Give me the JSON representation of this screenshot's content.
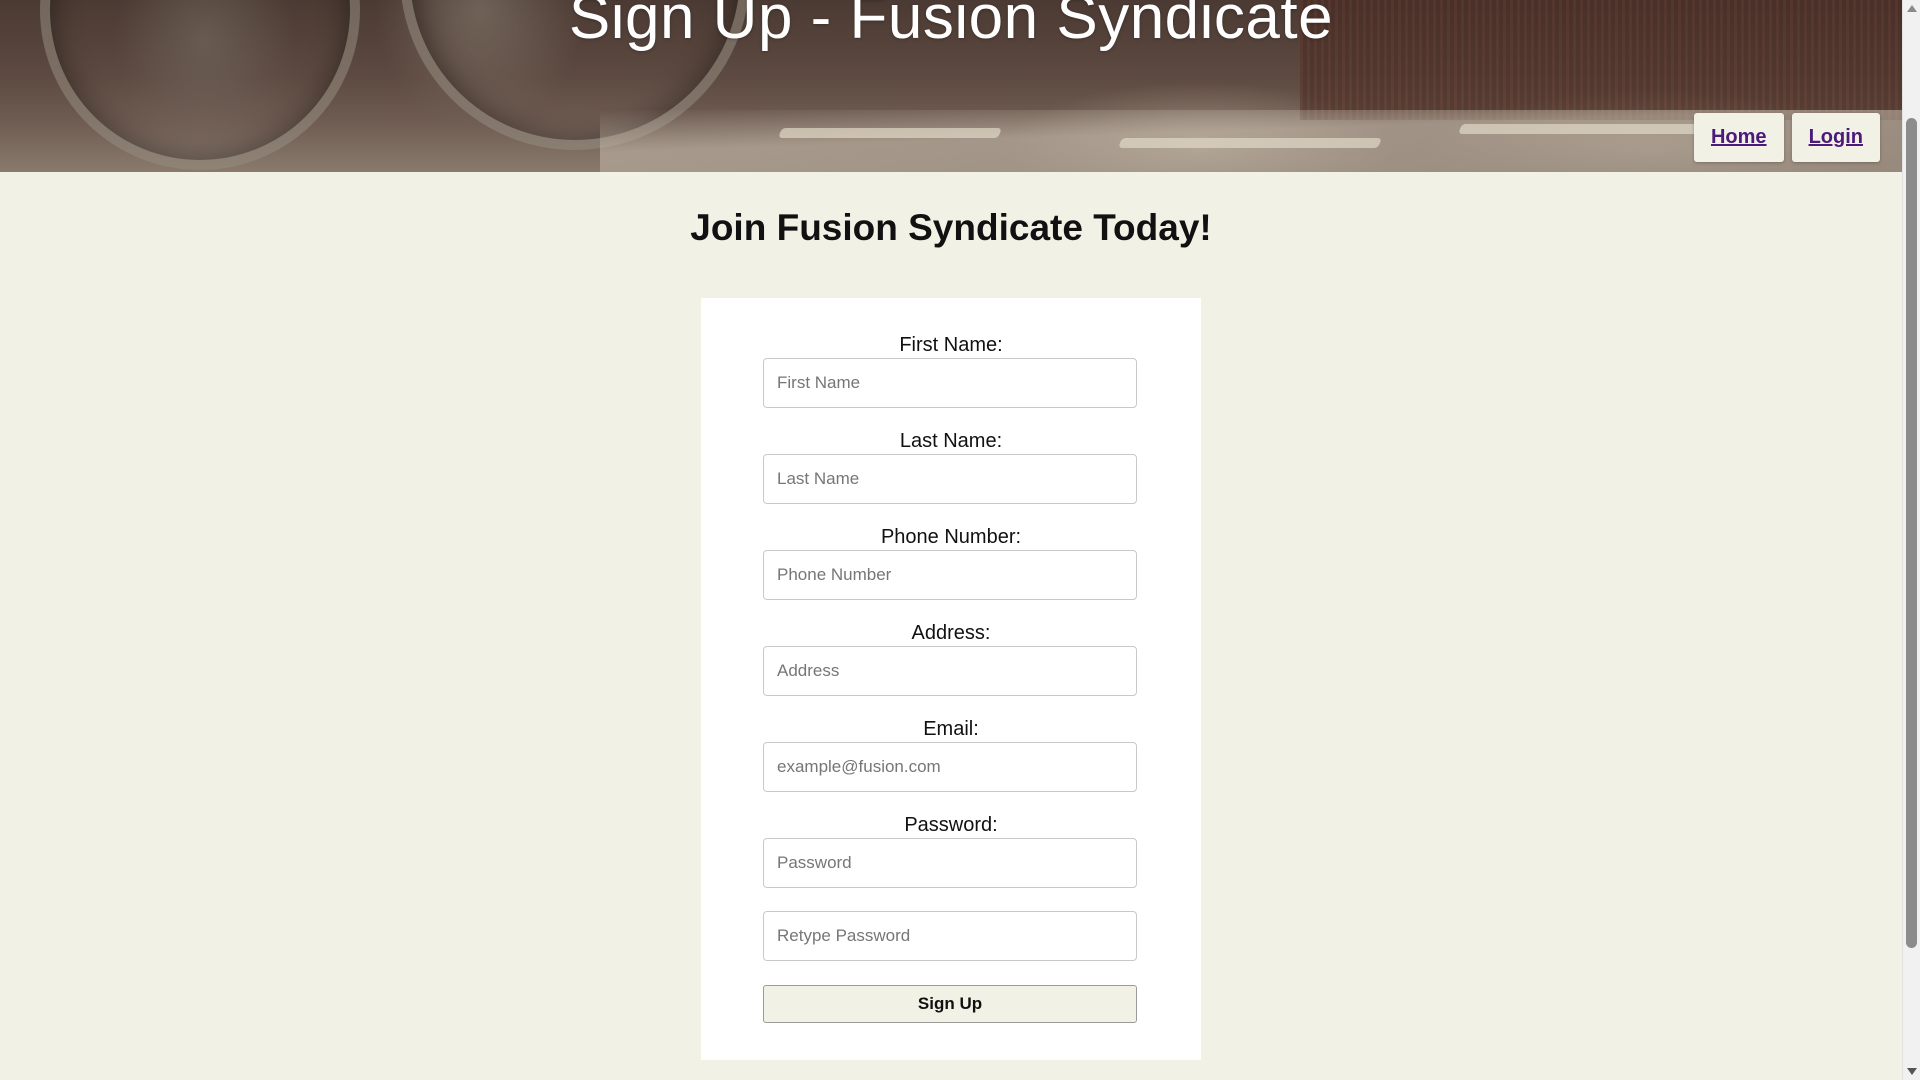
{
  "header": {
    "title": "Sign Up - Fusion Syndicate",
    "nav": [
      {
        "label": "Home"
      },
      {
        "label": "Login"
      }
    ]
  },
  "main": {
    "heading": "Join Fusion Syndicate Today!",
    "form": {
      "fields": [
        {
          "label": "First Name:",
          "placeholder": "First Name",
          "value": ""
        },
        {
          "label": "Last Name:",
          "placeholder": "Last Name",
          "value": ""
        },
        {
          "label": "Phone Number:",
          "placeholder": "Phone Number",
          "value": ""
        },
        {
          "label": "Address:",
          "placeholder": "Address",
          "value": ""
        },
        {
          "label": "Email:",
          "placeholder": "example@fusion.com",
          "value": ""
        },
        {
          "label": "Password:",
          "placeholder": "Password",
          "value": ""
        }
      ],
      "retype_password": {
        "placeholder": "Retype Password",
        "value": ""
      },
      "submit_label": "Sign Up"
    }
  },
  "colors": {
    "page_background": "#f2f1e6",
    "card_background": "#ffffff",
    "nav_link": "#4b1a7a"
  }
}
